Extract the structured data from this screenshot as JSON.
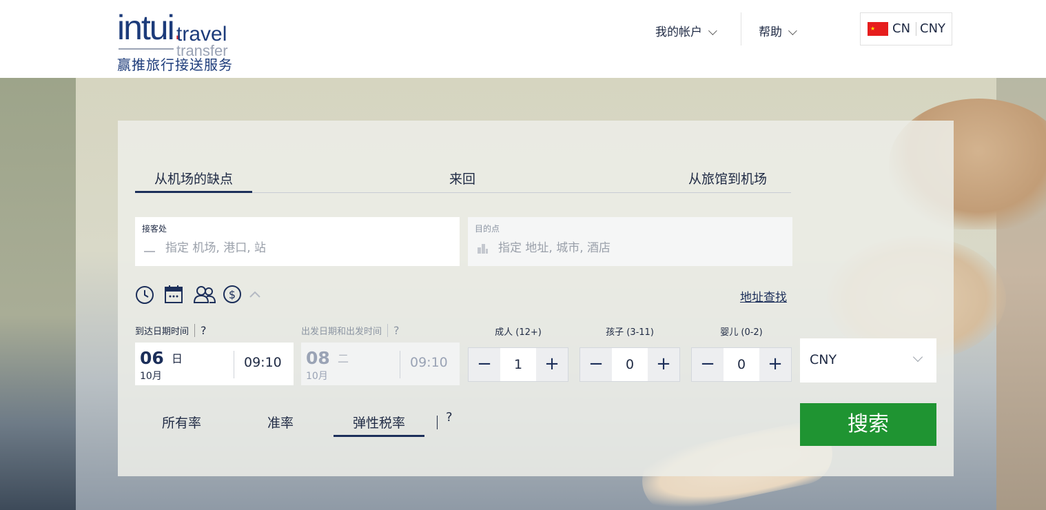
{
  "header": {
    "logo": {
      "brand": "intui",
      "dot": ".",
      "suffix": "travel",
      "sub": "transfer",
      "tagline": "赢推旅行接送服务"
    },
    "nav": [
      {
        "label": "我的帐户"
      },
      {
        "label": "帮助"
      }
    ],
    "locale": {
      "lang": "CN",
      "currency": "CNY"
    }
  },
  "tabs": [
    {
      "label": "从机场的缺点",
      "active": true
    },
    {
      "label": "来回",
      "active": false
    },
    {
      "label": "从旅馆到机场",
      "active": false
    }
  ],
  "pickup": {
    "label": "接客处",
    "placeholder": "指定 机场, 港口, 站",
    "value": ""
  },
  "destination": {
    "label": "目的点",
    "placeholder": "指定 地址, 城市, 酒店",
    "value": ""
  },
  "icons": [
    "clock-icon",
    "calendar-icon",
    "people-icon",
    "dollar-icon",
    "chevron-up-icon"
  ],
  "address_search": "地址查找",
  "arrival": {
    "label": "到达日期时间",
    "help": "?",
    "day": "06",
    "weekday": "日",
    "month": "10月",
    "time": "09:10"
  },
  "departure": {
    "label": "出发日期和出发时间",
    "help": "?",
    "day": "08",
    "weekday": "二",
    "month": "10月",
    "time": "09:10"
  },
  "passengers": [
    {
      "label": "成人 (12+)",
      "value": "1",
      "minus": "−",
      "plus": "+"
    },
    {
      "label": "孩子 (3-11)",
      "value": "0",
      "minus": "−",
      "plus": "+"
    },
    {
      "label": "婴儿 (0-2)",
      "value": "0",
      "minus": "−",
      "plus": "+"
    }
  ],
  "currency_select": {
    "value": "CNY"
  },
  "rate_tabs": [
    {
      "label": "所有率",
      "active": false
    },
    {
      "label": "准率",
      "active": false
    },
    {
      "label": "弹性税率",
      "active": true
    }
  ],
  "rate_help": "?",
  "search_button": "搜索",
  "colors": {
    "primary": "#1c2f5a",
    "search": "#1f9432",
    "flag": "#e61d1d"
  }
}
